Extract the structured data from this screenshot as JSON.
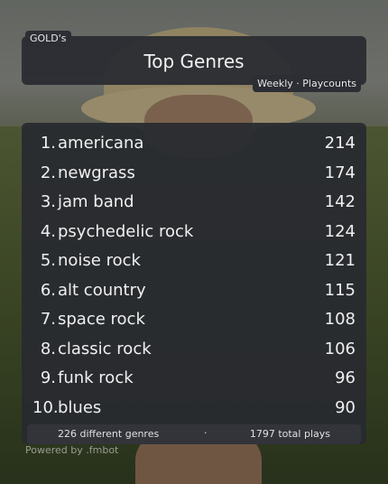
{
  "header": {
    "user_tag": "GOLD's",
    "title": "Top Genres",
    "period_tag": "Weekly · Playcounts"
  },
  "genres": [
    {
      "rank": "1.",
      "name": "americana",
      "count": "214"
    },
    {
      "rank": "2.",
      "name": "newgrass",
      "count": "174"
    },
    {
      "rank": "3.",
      "name": "jam band",
      "count": "142"
    },
    {
      "rank": "4.",
      "name": "psychedelic rock",
      "count": "124"
    },
    {
      "rank": "5.",
      "name": "noise rock",
      "count": "121"
    },
    {
      "rank": "6.",
      "name": "alt country",
      "count": "115"
    },
    {
      "rank": "7.",
      "name": "space rock",
      "count": "108"
    },
    {
      "rank": "8.",
      "name": "classic rock",
      "count": "106"
    },
    {
      "rank": "9.",
      "name": "funk rock",
      "count": "96"
    },
    {
      "rank": "10.",
      "name": "blues",
      "count": "90"
    }
  ],
  "footer": {
    "genres_total": "226 different genres",
    "separator": "·",
    "plays_total": "1797 total plays"
  },
  "powered_by": "Powered by .fmbot"
}
